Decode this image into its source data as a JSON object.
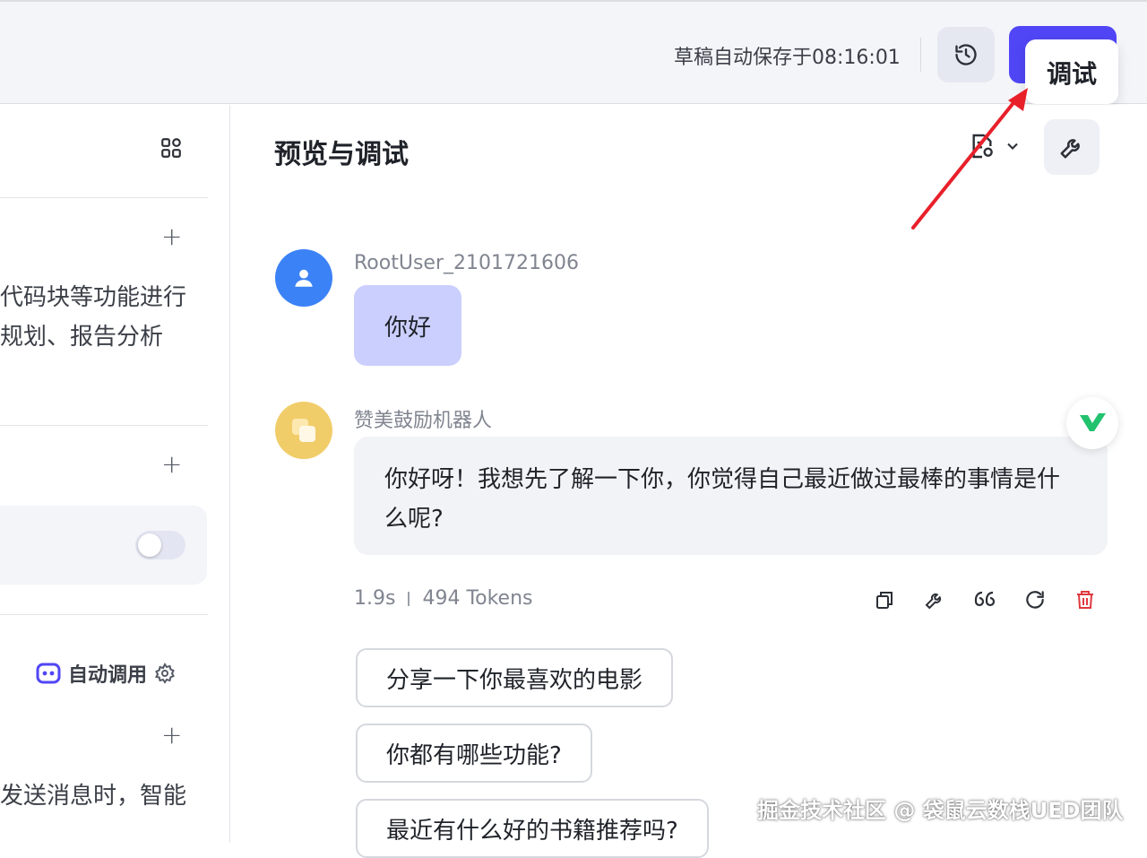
{
  "header": {
    "draft_status": "草稿自动保存于08:16:01",
    "history_icon": "history-icon",
    "tooltip": "调试"
  },
  "left_panel": {
    "text_block1": [
      "代码块等功能进行",
      "规划、报告分析"
    ],
    "auto_call_label": "自动调用",
    "text_block2": [
      "发送消息时，智能"
    ],
    "toggle_state": "off"
  },
  "preview": {
    "title": "预览与调试",
    "messages": [
      {
        "sender": "RootUser_2101721606",
        "text": "你好"
      },
      {
        "sender": "赞美鼓励机器人",
        "text": "你好呀！我想先了解一下你，你觉得自己最近做过最棒的事情是什么呢?"
      }
    ],
    "meta": {
      "time": "1.9s",
      "tokens": "494 Tokens"
    },
    "suggestions": [
      "分享一下你最喜欢的电影",
      "你都有哪些功能?",
      "最近有什么好的书籍推荐吗?"
    ]
  },
  "watermark": "掘金技术社区 @ 袋鼠云数栈UED团队",
  "colors": {
    "accent": "#5046f6",
    "user_bubble": "#cbcffd",
    "delete": "#e0383e"
  }
}
